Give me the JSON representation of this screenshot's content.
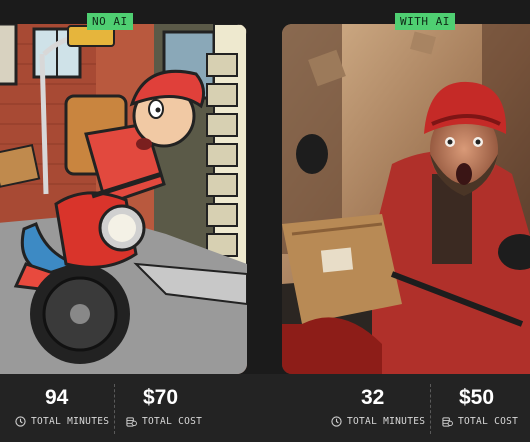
{
  "panels": [
    {
      "tag": "NO AI",
      "stats": [
        {
          "value": "94",
          "label": "TOTAL MINUTES",
          "icon": "clock-icon"
        },
        {
          "value": "$70",
          "label": "TOTAL COST",
          "icon": "coins-icon"
        }
      ]
    },
    {
      "tag": "WITH AI",
      "stats": [
        {
          "value": "32",
          "label": "TOTAL MINUTES",
          "icon": "clock-icon"
        },
        {
          "value": "$50",
          "label": "TOTAL COST",
          "icon": "coins-icon"
        }
      ]
    }
  ],
  "colors": {
    "tag_background": "#4fcf72",
    "page_background": "#1b1b1b",
    "stats_background": "#232323"
  }
}
